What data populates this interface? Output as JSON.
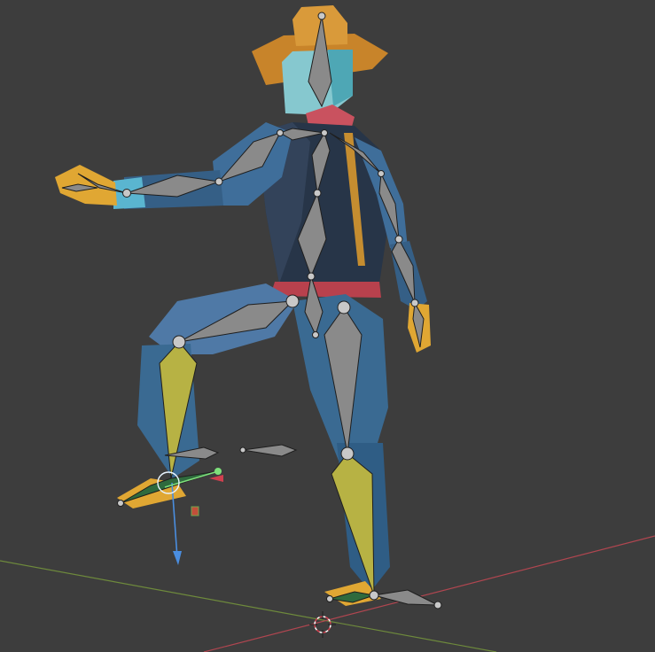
{
  "viewport": {
    "background": "#3d3d3d",
    "grid_axis_x_color": "#b04650",
    "grid_axis_y_color": "#6e8a3c",
    "gizmo_z_color": "#4a8ee0",
    "icons": [
      "3d-cursor-icon",
      "rotate-gizmo-icon",
      "scale-handle-icon"
    ]
  },
  "character": {
    "colors": {
      "hat": "#c8842a",
      "skin": "#86c8cf",
      "shirt": "#273548",
      "jacket": "#3f6e9a",
      "pants": "#3a6a92",
      "boots": "#e0a733",
      "belt": "#b8414d",
      "scarf": "#c9525f"
    }
  },
  "armature": {
    "bone_color": "#8a8a8a",
    "selected_chain_color": "#b7b244",
    "selected_foot_color": "#2f6a3d",
    "active_bone_highlight": "#7ee07b"
  }
}
